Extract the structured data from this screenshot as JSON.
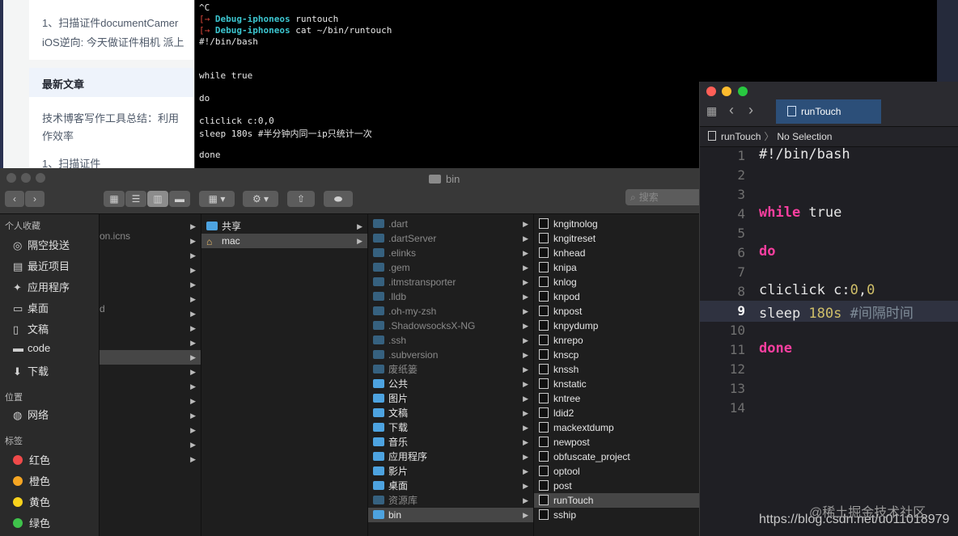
{
  "blog": {
    "line1": "1、扫描证件documentCamer",
    "line2": "iOS逆向: 今天做证件相机 派上",
    "recent_title": "最新文章",
    "recent_line1": "技术博客写作工具总结：利用",
    "recent_line2": "作效率",
    "recent_line3": "1、扫描证件"
  },
  "terminal": {
    "lines": [
      {
        "type": "plain",
        "text": "^C"
      },
      {
        "type": "prompt",
        "host": "Debug-iphoneos",
        "cmd": "runtouch"
      },
      {
        "type": "prompt",
        "host": "Debug-iphoneos",
        "cmd": "cat ~/bin/runtouch"
      },
      {
        "type": "plain",
        "text": "#!/bin/bash"
      },
      {
        "type": "plain",
        "text": ""
      },
      {
        "type": "plain",
        "text": ""
      },
      {
        "type": "plain",
        "text": "while true"
      },
      {
        "type": "plain",
        "text": ""
      },
      {
        "type": "plain",
        "text": "do"
      },
      {
        "type": "plain",
        "text": ""
      },
      {
        "type": "plain",
        "text": "cliclick c:0,0"
      },
      {
        "type": "plain",
        "text": "sleep 180s #半分钟内同一ip只统计一次"
      },
      {
        "type": "plain",
        "text": ""
      },
      {
        "type": "plain",
        "text": "done"
      }
    ]
  },
  "finder": {
    "title": "bin",
    "search_placeholder": "搜索",
    "favorites_label": "个人收藏",
    "favorites": [
      {
        "icon": "airdrop-icon",
        "glyph": "◎",
        "label": "隔空投送"
      },
      {
        "icon": "recents-icon",
        "glyph": "▤",
        "label": "最近项目"
      },
      {
        "icon": "applications-icon",
        "glyph": "✦",
        "label": "应用程序"
      },
      {
        "icon": "desktop-icon",
        "glyph": "▭",
        "label": "桌面"
      },
      {
        "icon": "documents-icon",
        "glyph": "▯",
        "label": "文稿"
      },
      {
        "icon": "folder-icon",
        "glyph": "▬",
        "label": "code"
      },
      {
        "icon": "downloads-icon",
        "glyph": "⬇",
        "label": "下载"
      }
    ],
    "locations_label": "位置",
    "locations": [
      {
        "icon": "network-icon",
        "glyph": "◍",
        "label": "网络"
      }
    ],
    "tags_label": "标签",
    "tags": [
      {
        "color": "#f04a4a",
        "label": "红色"
      },
      {
        "color": "#f5a623",
        "label": "橙色"
      },
      {
        "color": "#f8d21c",
        "label": "黄色"
      },
      {
        "color": "#3fc34b",
        "label": "绿色"
      }
    ],
    "col1": [
      "on.icns",
      "d"
    ],
    "col2": [
      {
        "label": "共享",
        "icon": "folder"
      },
      {
        "label": "mac",
        "icon": "home"
      }
    ],
    "col3": [
      {
        "label": ".dart",
        "dim": true
      },
      {
        "label": ".dartServer",
        "dim": true
      },
      {
        "label": ".elinks",
        "dim": true
      },
      {
        "label": ".gem",
        "dim": true
      },
      {
        "label": ".itmstransporter",
        "dim": true
      },
      {
        "label": ".lldb",
        "dim": true
      },
      {
        "label": ".oh-my-zsh",
        "dim": true
      },
      {
        "label": ".ShadowsocksX-NG",
        "dim": true
      },
      {
        "label": ".ssh",
        "dim": true
      },
      {
        "label": ".subversion",
        "dim": true
      },
      {
        "label": "废纸篓",
        "dim": true
      },
      {
        "label": "公共",
        "dim": false
      },
      {
        "label": "图片",
        "dim": false
      },
      {
        "label": "文稿",
        "dim": false
      },
      {
        "label": "下载",
        "dim": false
      },
      {
        "label": "音乐",
        "dim": false
      },
      {
        "label": "应用程序",
        "dim": false
      },
      {
        "label": "影片",
        "dim": false
      },
      {
        "label": "桌面",
        "dim": false
      },
      {
        "label": "资源库",
        "dim": true
      },
      {
        "label": "bin",
        "dim": false
      }
    ],
    "col4": [
      "kngitnolog",
      "kngitreset",
      "knhead",
      "knipa",
      "knlog",
      "knpod",
      "knpost",
      "knpydump",
      "knrepo",
      "knscp",
      "knssh",
      "knstatic",
      "kntree",
      "ldid2",
      "mackextdump",
      "newpost",
      "obfuscate_project",
      "optool",
      "post",
      "runTouch",
      "sship"
    ]
  },
  "xcode": {
    "tab_label": "runTouch",
    "breadcrumb_file": "runTouch",
    "breadcrumb_sel": "No Selection",
    "line_numbers": [
      "1",
      "2",
      "3",
      "4",
      "5",
      "6",
      "7",
      "8",
      "9",
      "10",
      "11",
      "12",
      "13",
      "14"
    ],
    "code": {
      "l1": "#!/bin/bash",
      "l4a": "while",
      "l4b": " true",
      "l6": "do",
      "l8a": "cliclick c:",
      "l8b": "0",
      "l8c": ",",
      "l8d": "0",
      "l9a": "sleep ",
      "l9b": "180s",
      "l9c": " #间隔时间",
      "l11": "done"
    }
  },
  "watermark": "https://blog.csdn.net/u011018979",
  "watermark2": "@稀土掘金技术社区"
}
